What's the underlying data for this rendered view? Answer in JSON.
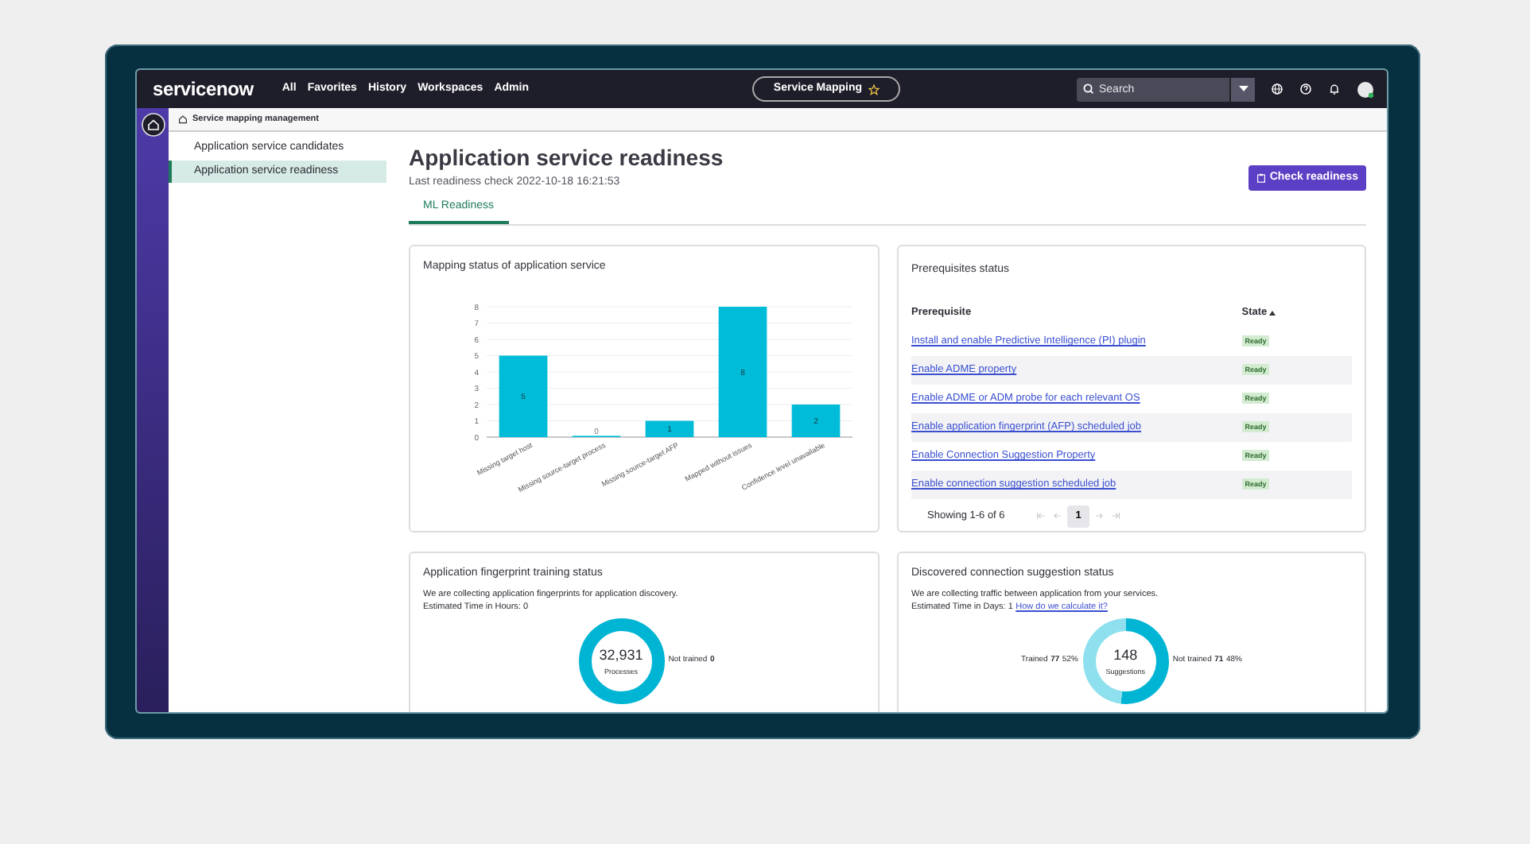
{
  "navbar": {
    "logo": "servicenow",
    "menu": [
      {
        "label": "All"
      },
      {
        "label": "Favorites"
      },
      {
        "label": "History"
      },
      {
        "label": "Workspaces"
      },
      {
        "label": "Admin"
      }
    ],
    "app_pill": "Service Mapping",
    "search": {
      "placeholder": "Search"
    }
  },
  "breadcrumb": "Service mapping management",
  "sidebar": {
    "items": [
      {
        "label": "Application service candidates",
        "selected": false
      },
      {
        "label": "Application service readiness",
        "selected": true
      }
    ]
  },
  "page": {
    "title": "Application service readiness",
    "subtitle": "Last readiness check 2022-10-18 16:21:53",
    "action": "Check readiness",
    "tabs": [
      {
        "label": "ML Readiness",
        "selected": true
      }
    ]
  },
  "mapping_card": {
    "title": "Mapping status of application service",
    "chart_data": {
      "type": "bar",
      "categories": [
        "Missing target host",
        "Missing source-target process",
        "Missing source-target AFP",
        "Mapped without issues",
        "Confidence level unavailable"
      ],
      "values": [
        5,
        0,
        1,
        8,
        2
      ],
      "ylim": [
        0,
        8
      ],
      "yticks": [
        0,
        1,
        2,
        3,
        4,
        5,
        6,
        7,
        8
      ],
      "data_labels": true,
      "grid": true,
      "color": "#00bcd8"
    }
  },
  "prereq_card": {
    "title": "Prerequisites status",
    "columns": [
      {
        "label": "Prerequisite",
        "sorted": false
      },
      {
        "label": "State",
        "sorted": true
      }
    ],
    "rows": [
      {
        "prerequisite": "Install and enable Predictive Intelligence (PI) plugin",
        "state": "Ready"
      },
      {
        "prerequisite": "Enable ADME property",
        "state": "Ready"
      },
      {
        "prerequisite": "Enable ADME or ADM probe for each relevant OS",
        "state": "Ready"
      },
      {
        "prerequisite": "Enable application fingerprint (AFP) scheduled job",
        "state": "Ready"
      },
      {
        "prerequisite": "Enable Connection Suggestion Property",
        "state": "Ready"
      },
      {
        "prerequisite": "Enable connection suggestion scheduled job",
        "state": "Ready"
      }
    ],
    "showing": "Showing 1-6 of 6",
    "pages": [
      {
        "label": "1",
        "selected": true
      }
    ]
  },
  "fingerprint_card": {
    "title": "Application fingerprint training status",
    "lines": [
      "We are collecting application fingerprints for application discovery.",
      "Estimated Time in Hours: 0"
    ],
    "center_value": "32,931",
    "center_label": "Processes",
    "labels": [
      {
        "label": "Not trained",
        "count": "0"
      }
    ]
  },
  "connection_card": {
    "title": "Discovered connection suggestion status",
    "lines": [
      "We are collecting traffic between application from your services.",
      "Estimated Time in Days: 1"
    ],
    "link": "How do we calculate it?",
    "center_value": "148",
    "center_label": "Suggestions",
    "labels": [
      {
        "count": "77",
        "percent": "52%"
      },
      {
        "count": "71",
        "percent": "48%"
      }
    ],
    "chart_data": {
      "type": "donut",
      "categories": [
        "Trained",
        "Not trained"
      ],
      "values": [
        52,
        48
      ],
      "colors": [
        "#00b4d3",
        "#8fe0ee"
      ]
    }
  }
}
